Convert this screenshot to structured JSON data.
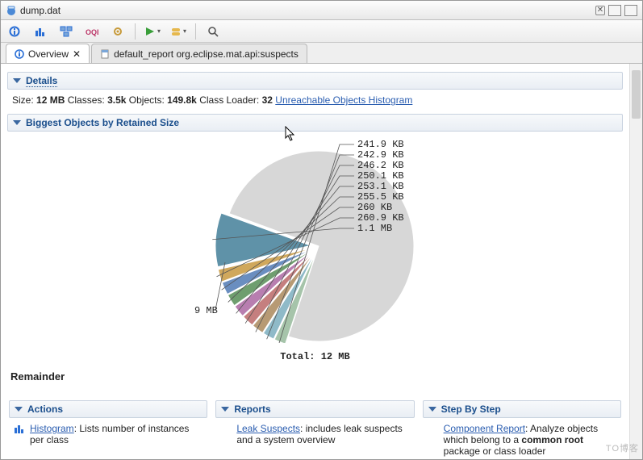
{
  "window": {
    "file_title": "dump.dat"
  },
  "tabs": {
    "overview": "Overview",
    "report": "default_report  org.eclipse.mat.api:suspects"
  },
  "details": {
    "section_title": "Details",
    "size_label": "Size:",
    "size_value": "12 MB",
    "classes_label": "Classes:",
    "classes_value": "3.5k",
    "objects_label": "Objects:",
    "objects_value": "149.8k",
    "classloader_label": "Class Loader:",
    "classloader_value": "32",
    "link_text": "Unreachable Objects Histogram"
  },
  "biggest": {
    "section_title": "Biggest Objects by Retained Size"
  },
  "chart_data": {
    "type": "pie",
    "title": "",
    "total_label": "Total: 12 MB",
    "remainder": {
      "label": "9 MB",
      "value_mb": 9.0,
      "color": "#d7d7d7"
    },
    "slices": [
      {
        "label": "241.9 KB",
        "value_kb": 241.9,
        "color": "#a6c4aa"
      },
      {
        "label": "242.9 KB",
        "value_kb": 242.9,
        "color": "#8fbac8"
      },
      {
        "label": "246.2 KB",
        "value_kb": 246.2,
        "color": "#b79a74"
      },
      {
        "label": "250.1 KB",
        "value_kb": 250.1,
        "color": "#c57f7f"
      },
      {
        "label": "253.1 KB",
        "value_kb": 253.1,
        "color": "#b87eb0"
      },
      {
        "label": "255.5 KB",
        "value_kb": 255.5,
        "color": "#6f9e6f"
      },
      {
        "label": "260 KB",
        "value_kb": 260.0,
        "color": "#6a8ec0"
      },
      {
        "label": "260.9 KB",
        "value_kb": 260.9,
        "color": "#d0a85c"
      },
      {
        "label": "1.1 MB",
        "value_kb": 1126.4,
        "color": "#5f92a8"
      }
    ],
    "remainder_title": "Remainder"
  },
  "actions": {
    "section_title": "Actions",
    "histogram_link": "Histogram",
    "histogram_text": ": Lists number of instances per class"
  },
  "reports": {
    "section_title": "Reports",
    "leak_link": "Leak Suspects",
    "leak_text": ": includes leak suspects and a system overview"
  },
  "stepbystep": {
    "section_title": "Step By Step",
    "comp_link": "Component Report",
    "comp_text_1": ": Analyze objects which belong to a ",
    "comp_bold": "common root",
    "comp_text_2": " package or class loader"
  },
  "watermark": "TO博客"
}
